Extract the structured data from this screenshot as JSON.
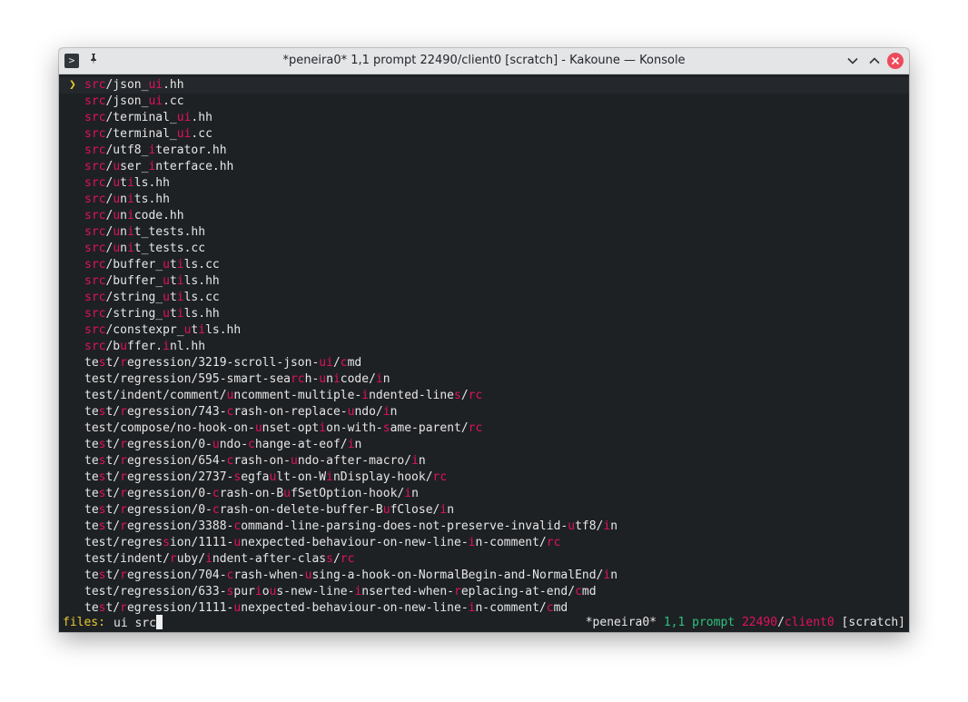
{
  "window": {
    "title": "*peneira0* 1,1 prompt 22490/client0 [scratch] - Kakoune — Konsole"
  },
  "menu": {
    "selected_index": 0,
    "marker": "❯",
    "items": [
      {
        "segments": [
          [
            "src",
            "m"
          ],
          [
            "/json_",
            ""
          ],
          [
            "ui",
            "m"
          ],
          [
            ".hh",
            ""
          ]
        ]
      },
      {
        "segments": [
          [
            "src",
            "m"
          ],
          [
            "/json_",
            ""
          ],
          [
            "ui",
            "m"
          ],
          [
            ".cc",
            ""
          ]
        ]
      },
      {
        "segments": [
          [
            "src",
            "m"
          ],
          [
            "/terminal_",
            ""
          ],
          [
            "ui",
            "m"
          ],
          [
            ".hh",
            ""
          ]
        ]
      },
      {
        "segments": [
          [
            "src",
            "m"
          ],
          [
            "/terminal_",
            ""
          ],
          [
            "ui",
            "m"
          ],
          [
            ".cc",
            ""
          ]
        ]
      },
      {
        "segments": [
          [
            "src",
            "m"
          ],
          [
            "/utf8_",
            ""
          ],
          [
            "i",
            "m"
          ],
          [
            "terator.hh",
            ""
          ]
        ]
      },
      {
        "segments": [
          [
            "src",
            "m"
          ],
          [
            "/",
            ""
          ],
          [
            "u",
            "m"
          ],
          [
            "ser_",
            ""
          ],
          [
            "i",
            "m"
          ],
          [
            "nterface.hh",
            ""
          ]
        ]
      },
      {
        "segments": [
          [
            "src",
            "m"
          ],
          [
            "/",
            ""
          ],
          [
            "u",
            "m"
          ],
          [
            "t",
            ""
          ],
          [
            "i",
            "m"
          ],
          [
            "ls.hh",
            ""
          ]
        ]
      },
      {
        "segments": [
          [
            "src",
            "m"
          ],
          [
            "/",
            ""
          ],
          [
            "u",
            "m"
          ],
          [
            "n",
            ""
          ],
          [
            "i",
            "m"
          ],
          [
            "ts.hh",
            ""
          ]
        ]
      },
      {
        "segments": [
          [
            "src",
            "m"
          ],
          [
            "/",
            ""
          ],
          [
            "u",
            "m"
          ],
          [
            "n",
            ""
          ],
          [
            "i",
            "m"
          ],
          [
            "code.hh",
            ""
          ]
        ]
      },
      {
        "segments": [
          [
            "src",
            "m"
          ],
          [
            "/",
            ""
          ],
          [
            "u",
            "m"
          ],
          [
            "n",
            ""
          ],
          [
            "i",
            "m"
          ],
          [
            "t_tests.hh",
            ""
          ]
        ]
      },
      {
        "segments": [
          [
            "src",
            "m"
          ],
          [
            "/",
            ""
          ],
          [
            "u",
            "m"
          ],
          [
            "n",
            ""
          ],
          [
            "i",
            "m"
          ],
          [
            "t_tests.cc",
            ""
          ]
        ]
      },
      {
        "segments": [
          [
            "src",
            "m"
          ],
          [
            "/buffer_",
            ""
          ],
          [
            "u",
            "m"
          ],
          [
            "t",
            ""
          ],
          [
            "i",
            "m"
          ],
          [
            "ls.cc",
            ""
          ]
        ]
      },
      {
        "segments": [
          [
            "src",
            "m"
          ],
          [
            "/buffer_",
            ""
          ],
          [
            "u",
            "m"
          ],
          [
            "t",
            ""
          ],
          [
            "i",
            "m"
          ],
          [
            "ls.hh",
            ""
          ]
        ]
      },
      {
        "segments": [
          [
            "src",
            "m"
          ],
          [
            "/string_",
            ""
          ],
          [
            "u",
            "m"
          ],
          [
            "t",
            ""
          ],
          [
            "i",
            "m"
          ],
          [
            "ls.cc",
            ""
          ]
        ]
      },
      {
        "segments": [
          [
            "src",
            "m"
          ],
          [
            "/string_",
            ""
          ],
          [
            "u",
            "m"
          ],
          [
            "t",
            ""
          ],
          [
            "i",
            "m"
          ],
          [
            "ls.hh",
            ""
          ]
        ]
      },
      {
        "segments": [
          [
            "src",
            "m"
          ],
          [
            "/constexpr_",
            ""
          ],
          [
            "u",
            "m"
          ],
          [
            "t",
            ""
          ],
          [
            "i",
            "m"
          ],
          [
            "ls.hh",
            ""
          ]
        ]
      },
      {
        "segments": [
          [
            "src",
            "m"
          ],
          [
            "/b",
            ""
          ],
          [
            "u",
            "m"
          ],
          [
            "ffer.",
            ""
          ],
          [
            "i",
            "m"
          ],
          [
            "nl.hh",
            ""
          ]
        ]
      },
      {
        "segments": [
          [
            "te",
            ""
          ],
          [
            "s",
            "m"
          ],
          [
            "t/",
            ""
          ],
          [
            "r",
            "m"
          ],
          [
            "egression/3219-scroll-json-",
            ""
          ],
          [
            "ui",
            "m"
          ],
          [
            "/",
            ""
          ],
          [
            "c",
            "m"
          ],
          [
            "md",
            ""
          ]
        ]
      },
      {
        "segments": [
          [
            "test/regression/595-smart-sea",
            ""
          ],
          [
            "rc",
            "m"
          ],
          [
            "h-",
            ""
          ],
          [
            "u",
            "m"
          ],
          [
            "n",
            ""
          ],
          [
            "i",
            "m"
          ],
          [
            "code/",
            ""
          ],
          [
            "i",
            "m"
          ],
          [
            "n",
            ""
          ]
        ]
      },
      {
        "segments": [
          [
            "test/indent/comment/",
            ""
          ],
          [
            "u",
            "m"
          ],
          [
            "ncomment-multiple-",
            ""
          ],
          [
            "i",
            "m"
          ],
          [
            "ndented-line",
            ""
          ],
          [
            "s",
            "m"
          ],
          [
            "/",
            ""
          ],
          [
            "rc",
            "m"
          ]
        ]
      },
      {
        "segments": [
          [
            "te",
            ""
          ],
          [
            "s",
            "m"
          ],
          [
            "t/",
            ""
          ],
          [
            "r",
            "m"
          ],
          [
            "egression/743-",
            ""
          ],
          [
            "c",
            "m"
          ],
          [
            "rash-on-replace-",
            ""
          ],
          [
            "u",
            "m"
          ],
          [
            "ndo/",
            ""
          ],
          [
            "i",
            "m"
          ],
          [
            "n",
            ""
          ]
        ]
      },
      {
        "segments": [
          [
            "test/compose/no-hook-on-",
            ""
          ],
          [
            "u",
            "m"
          ],
          [
            "nset-opt",
            ""
          ],
          [
            "i",
            "m"
          ],
          [
            "on-with-",
            ""
          ],
          [
            "s",
            "m"
          ],
          [
            "ame-parent/",
            ""
          ],
          [
            "rc",
            "m"
          ]
        ]
      },
      {
        "segments": [
          [
            "te",
            ""
          ],
          [
            "s",
            "m"
          ],
          [
            "t/",
            ""
          ],
          [
            "r",
            "m"
          ],
          [
            "egression/0-",
            ""
          ],
          [
            "u",
            "m"
          ],
          [
            "ndo-",
            ""
          ],
          [
            "c",
            "m"
          ],
          [
            "hange-at-eof/",
            ""
          ],
          [
            "i",
            "m"
          ],
          [
            "n",
            ""
          ]
        ]
      },
      {
        "segments": [
          [
            "te",
            ""
          ],
          [
            "s",
            "m"
          ],
          [
            "t/",
            ""
          ],
          [
            "r",
            "m"
          ],
          [
            "egression/654-",
            ""
          ],
          [
            "c",
            "m"
          ],
          [
            "rash-on-",
            ""
          ],
          [
            "u",
            "m"
          ],
          [
            "ndo-after-macro/",
            ""
          ],
          [
            "i",
            "m"
          ],
          [
            "n",
            ""
          ]
        ]
      },
      {
        "segments": [
          [
            "te",
            ""
          ],
          [
            "s",
            "m"
          ],
          [
            "t/",
            ""
          ],
          [
            "r",
            "m"
          ],
          [
            "egression/2737-",
            ""
          ],
          [
            "s",
            "m"
          ],
          [
            "egfa",
            ""
          ],
          [
            "u",
            "m"
          ],
          [
            "lt-on-W",
            ""
          ],
          [
            "i",
            "m"
          ],
          [
            "nDisplay-hook/",
            ""
          ],
          [
            "rc",
            "m"
          ]
        ]
      },
      {
        "segments": [
          [
            "te",
            ""
          ],
          [
            "s",
            "m"
          ],
          [
            "t/",
            ""
          ],
          [
            "r",
            "m"
          ],
          [
            "egression/0-",
            ""
          ],
          [
            "c",
            "m"
          ],
          [
            "rash-on-B",
            ""
          ],
          [
            "u",
            "m"
          ],
          [
            "fSetOption-hook/",
            ""
          ],
          [
            "i",
            "m"
          ],
          [
            "n",
            ""
          ]
        ]
      },
      {
        "segments": [
          [
            "te",
            ""
          ],
          [
            "s",
            "m"
          ],
          [
            "t/",
            ""
          ],
          [
            "r",
            "m"
          ],
          [
            "egression/0-",
            ""
          ],
          [
            "c",
            "m"
          ],
          [
            "rash-on-delete-buffer-B",
            ""
          ],
          [
            "u",
            "m"
          ],
          [
            "fClose/",
            ""
          ],
          [
            "i",
            "m"
          ],
          [
            "n",
            ""
          ]
        ]
      },
      {
        "segments": [
          [
            "te",
            ""
          ],
          [
            "s",
            "m"
          ],
          [
            "t/",
            ""
          ],
          [
            "r",
            "m"
          ],
          [
            "egression/3388-",
            ""
          ],
          [
            "c",
            "m"
          ],
          [
            "ommand-line-parsing-does-not-preserve-invalid-",
            ""
          ],
          [
            "u",
            "m"
          ],
          [
            "tf8/",
            ""
          ],
          [
            "i",
            "m"
          ],
          [
            "n",
            ""
          ]
        ]
      },
      {
        "segments": [
          [
            "test/regres",
            ""
          ],
          [
            "s",
            "m"
          ],
          [
            "ion/1111-",
            ""
          ],
          [
            "u",
            "m"
          ],
          [
            "nexpected-behaviour-on-new-line-",
            ""
          ],
          [
            "i",
            "m"
          ],
          [
            "n-comment/",
            ""
          ],
          [
            "rc",
            "m"
          ]
        ]
      },
      {
        "segments": [
          [
            "test/indent/",
            ""
          ],
          [
            "r",
            "m"
          ],
          [
            "uby/",
            ""
          ],
          [
            "i",
            "m"
          ],
          [
            "ndent-after-clas",
            ""
          ],
          [
            "s",
            "m"
          ],
          [
            "/",
            ""
          ],
          [
            "rc",
            "m"
          ]
        ]
      },
      {
        "segments": [
          [
            "te",
            ""
          ],
          [
            "s",
            "m"
          ],
          [
            "t/",
            ""
          ],
          [
            "r",
            "m"
          ],
          [
            "egression/704-",
            ""
          ],
          [
            "c",
            "m"
          ],
          [
            "rash-when-",
            ""
          ],
          [
            "u",
            "m"
          ],
          [
            "sing-a-hook-on-NormalBegin-and-NormalEnd/",
            ""
          ],
          [
            "i",
            "m"
          ],
          [
            "n",
            ""
          ]
        ]
      },
      {
        "segments": [
          [
            "test/regression/633-",
            ""
          ],
          [
            "s",
            "m"
          ],
          [
            "pur",
            ""
          ],
          [
            "i",
            "m"
          ],
          [
            "o",
            ""
          ],
          [
            "u",
            "m"
          ],
          [
            "s-new-line-",
            ""
          ],
          [
            "i",
            "m"
          ],
          [
            "nserted-when-",
            ""
          ],
          [
            "r",
            "m"
          ],
          [
            "eplacing-at-end/",
            ""
          ],
          [
            "c",
            "m"
          ],
          [
            "md",
            ""
          ]
        ]
      },
      {
        "segments": [
          [
            "te",
            ""
          ],
          [
            "s",
            "m"
          ],
          [
            "t/",
            ""
          ],
          [
            "r",
            "m"
          ],
          [
            "egression/1111-",
            ""
          ],
          [
            "u",
            "m"
          ],
          [
            "nexpected-behaviour-on-new-line-",
            ""
          ],
          [
            "i",
            "m"
          ],
          [
            "n-comment/",
            ""
          ],
          [
            "c",
            "m"
          ],
          [
            "md",
            ""
          ]
        ]
      }
    ]
  },
  "prompt": {
    "label": "files:",
    "input": "ui src"
  },
  "status": {
    "buffer": "*peneira0*",
    "cursor": "1,1",
    "mode": "prompt",
    "pid": "22490",
    "sep": "/",
    "client": "client0",
    "scratch": "[scratch]"
  },
  "colors": {
    "match": "#e0115f",
    "marker": "#e8c832",
    "prompt_label": "#e8c832",
    "status_green": "#2ec27e",
    "background": "#1e2124",
    "close_button": "#ed4b5c"
  },
  "icons": [
    "terminal-app-icon",
    "pin-icon",
    "minimize-chevron-icon",
    "maximize-chevron-icon",
    "close-icon"
  ]
}
